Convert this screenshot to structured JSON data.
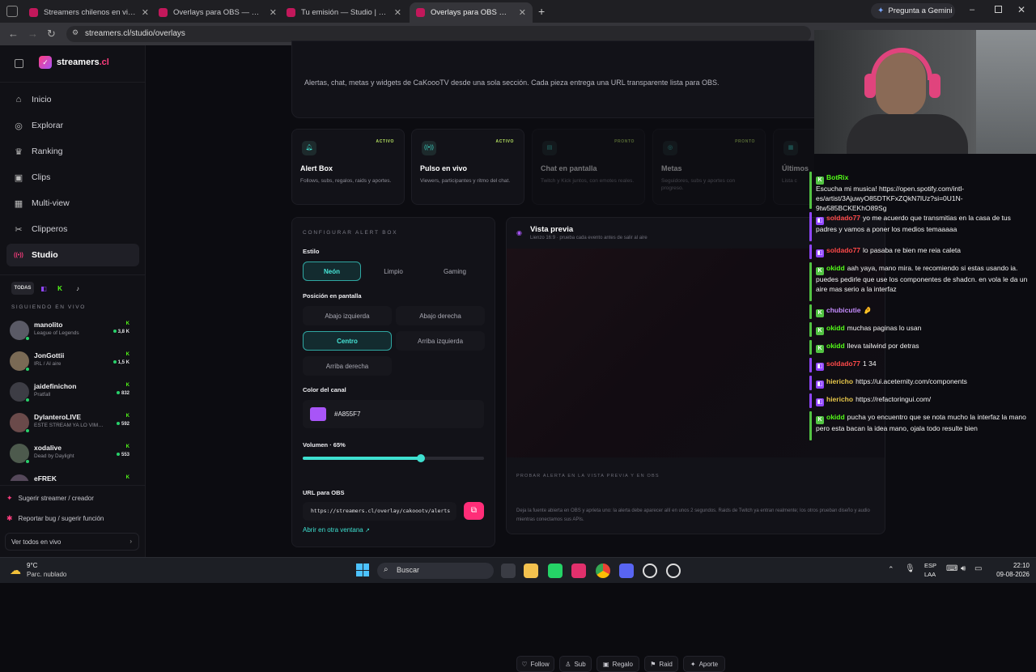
{
  "browser": {
    "tabs": [
      {
        "title": "Streamers chilenos en vivo | Tw",
        "active": false
      },
      {
        "title": "Overlays para OBS — Streamers",
        "active": false
      },
      {
        "title": "Tu emisión — Studio | streamers",
        "active": false
      },
      {
        "title": "Overlays para OBS — Streamers",
        "active": true
      }
    ],
    "gemini_label": "Pregunta a Gemini",
    "url": "streamers.cl/studio/overlays"
  },
  "app": {
    "brand": "streamers",
    "brand_suffix": ".cl",
    "accent": "#ff3d7f",
    "nav": [
      {
        "label": "Inicio",
        "icon": "home-icon",
        "glyph": "⌂"
      },
      {
        "label": "Explorar",
        "icon": "compass-icon",
        "glyph": "◎"
      },
      {
        "label": "Ranking",
        "icon": "trophy-icon",
        "glyph": "♛"
      },
      {
        "label": "Clips",
        "icon": "film-icon",
        "glyph": "▣"
      },
      {
        "label": "Multi-view",
        "icon": "grid-icon",
        "glyph": "▦"
      },
      {
        "label": "Clipperos",
        "icon": "scissors-icon",
        "glyph": "✂"
      },
      {
        "label": "Studio",
        "icon": "broadcast-icon",
        "glyph": "((•))"
      }
    ],
    "filters": {
      "all": "TODAS",
      "twitch": "◧",
      "kick": "K",
      "tiktok": "♪"
    },
    "following_header": "SIGUIENDO EN VIVO",
    "following": [
      {
        "name": "manolito",
        "game": "League of Legends",
        "platform": "K",
        "viewers": "3,8 K"
      },
      {
        "name": "JonGottii",
        "game": "IRL / Al aire",
        "platform": "K",
        "viewers": "1,5 K"
      },
      {
        "name": "jaidefinichon",
        "game": "Pratfall",
        "platform": "K",
        "viewers": "832"
      },
      {
        "name": "DylanteroLIVE",
        "game": "ESTE STREAM YA LO VIM…",
        "platform": "K",
        "viewers": "592"
      },
      {
        "name": "xodalive",
        "game": "Dead by Daylight",
        "platform": "K",
        "viewers": "553"
      },
      {
        "name": "eFREK",
        "game": "",
        "platform": "K",
        "viewers": ""
      }
    ],
    "bottom_links": {
      "suggest": "Sugerir streamer / creador",
      "report": "Reportar bug / sugerir función",
      "view_all": "Ver todos en vivo"
    }
  },
  "intro": "Alertas, chat, metas y widgets de CaKoooTV desde una sola sección. Cada pieza entrega una URL transparente lista para OBS.",
  "features": [
    {
      "title": "Alert Box",
      "desc": "Follows, subs, regalos, raids y aportes.",
      "badge": "ACTIVO",
      "icon": "bell-icon",
      "glyph": "🔔︎"
    },
    {
      "title": "Pulso en vivo",
      "desc": "Viewers, participantes y ritmo del chat.",
      "badge": "ACTIVO",
      "icon": "pulse-icon",
      "glyph": "((•))"
    },
    {
      "title": "Chat en pantalla",
      "desc": "Twitch y Kick juntos, con emotes reales.",
      "badge": "PRONTO",
      "icon": "chat-icon",
      "glyph": "▤"
    },
    {
      "title": "Metas",
      "desc": "Seguidores, subs y aportes con progreso.",
      "badge": "PRONTO",
      "icon": "target-icon",
      "glyph": "◎"
    },
    {
      "title": "Últimos",
      "desc": "Lista c",
      "badge": "",
      "icon": "list-icon",
      "glyph": "▦"
    }
  ],
  "config": {
    "header": "CONFIGURAR ALERT BOX",
    "style_label": "Estilo",
    "styles": [
      "Neón",
      "Limpio",
      "Gaming"
    ],
    "style_selected": "Neón",
    "position_label": "Posición en pantalla",
    "positions": [
      "Abajo izquierda",
      "Abajo derecha",
      "Centro",
      "Arriba izquierda",
      "Arriba derecha"
    ],
    "position_selected": "Centro",
    "color_label": "Color del canal",
    "color_value": "#A855F7",
    "volume_label": "Volumen · 65%",
    "volume": 0.65,
    "url_label": "URL para OBS",
    "url_value": "https://streamers.cl/overlay/cakoootv/alerts",
    "open_link": "Abrir en otra ventana"
  },
  "preview": {
    "title": "Vista previa",
    "subtitle": "Lienzo 16:9 · prueba cada evento antes de salir al aire",
    "test_header": "PROBAR ALERTA EN LA VISTA PREVIA Y EN OBS",
    "events": [
      {
        "label": "Follow",
        "glyph": "♡",
        "icon": "heart-icon"
      },
      {
        "label": "Sub",
        "glyph": "♙",
        "icon": "user-icon"
      },
      {
        "label": "Regalo",
        "glyph": "▣",
        "icon": "gift-icon"
      },
      {
        "label": "Raid",
        "glyph": "⚑",
        "icon": "flag-icon"
      },
      {
        "label": "Aporte",
        "glyph": "✦",
        "icon": "sparkle-icon"
      }
    ],
    "note": "Deja la fuente abierta en OBS y aprieta uno: la alerta debe aparecer allí en unos 2 segundos. Raids de Twitch ya entran realmente; los otros prueban diseño y audio mientras conectamos sus APIs."
  },
  "chat": [
    {
      "platform": "kick",
      "user": "BotRix",
      "color": "#53fc18",
      "text": "Escucha mi musica! https://open.spotify.com/intl-es/artist/3AjuwyO85DTKFxZQkN7lUz?si=0U1N-9tw585BCKEKhO89Sg"
    },
    {
      "platform": "twitch",
      "user": "soldado77",
      "color": "#ff4a4a",
      "text": "yo me acuerdo que transmitias en la casa de tus padres y vamos a poner los medios temaaaaa"
    },
    {
      "platform": "twitch",
      "user": "soldado77",
      "color": "#ff4a4a",
      "text": "lo pasaba re bien me reia caleta"
    },
    {
      "platform": "kick",
      "user": "okidd",
      "color": "#53fc18",
      "text": "aah yaya, mano mira. te recomiendo si estas usando ia. puedes pedirle que use los componentes de shadcn. en vola le da un aire mas serio a la interfaz"
    },
    {
      "platform": "kick",
      "user": "chubicutie",
      "color": "#c58cff",
      "text": "🤌"
    },
    {
      "platform": "kick",
      "user": "okidd",
      "color": "#53fc18",
      "text": "muchas paginas lo usan"
    },
    {
      "platform": "kick",
      "user": "okidd",
      "color": "#53fc18",
      "text": "lleva tailwind por detras"
    },
    {
      "platform": "twitch",
      "user": "soldado77",
      "color": "#ff4a4a",
      "text": "1 34"
    },
    {
      "platform": "twitch",
      "user": "hiericho",
      "color": "#e6c64a",
      "text": "https://ui.aceternity.com/components"
    },
    {
      "platform": "twitch",
      "user": "hiericho",
      "color": "#e6c64a",
      "text": "https://refactoringui.com/"
    },
    {
      "platform": "kick",
      "user": "okidd",
      "color": "#53fc18",
      "text": "pucha yo encuentro que se nota mucho la interfaz la mano pero esta bacan la idea mano, ojala todo resulte bien"
    }
  ],
  "taskbar": {
    "weather_temp": "9°C",
    "weather_desc": "Parc. nublado",
    "search": "Buscar",
    "lang": "ESP",
    "lang2": "LAA",
    "time": "22:10",
    "date": "09-08-2026"
  }
}
